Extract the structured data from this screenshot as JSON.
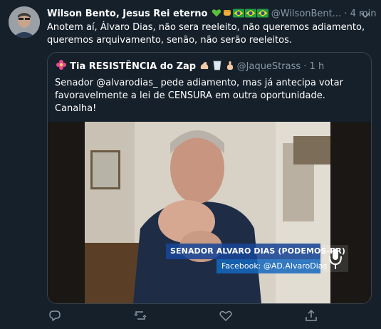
{
  "tweet": {
    "display_name": "Wilson Bento, Jesus Rei eterno",
    "handle": "@WilsonBent...",
    "dot": "·",
    "time": "4 min",
    "text_line1": "Anotem aí, Álvaro Dias, não sera  reeleito, não queremos adiamento,",
    "text_line2": "queremos arquivamento, senão, não serão reeleitos."
  },
  "quote": {
    "display_name": "Tia RESISTÊNCIA do Zap",
    "handle": "@JaqueStrass",
    "dot": "·",
    "time": "1 h",
    "text_line1": "Senador @alvarodias_ pede adiamento, mas já antecipa votar",
    "text_line2": "favoravelmente a lei de CENSURA em outra oportunidade.",
    "text_line3": "Canalha!",
    "video": {
      "chyron_name": "SENADOR ALVARO DIAS (PODEMOS-PR)",
      "chyron_social": "Facebook: @AD.AlvaroDias"
    }
  },
  "icons": [
    "more-icon",
    "reply-icon",
    "retweet-icon",
    "like-icon",
    "share-icon"
  ],
  "colors": {
    "background": "#15202b",
    "border": "#38444d",
    "secondary_text": "#8899a6",
    "primary_text": "#ffffff"
  }
}
